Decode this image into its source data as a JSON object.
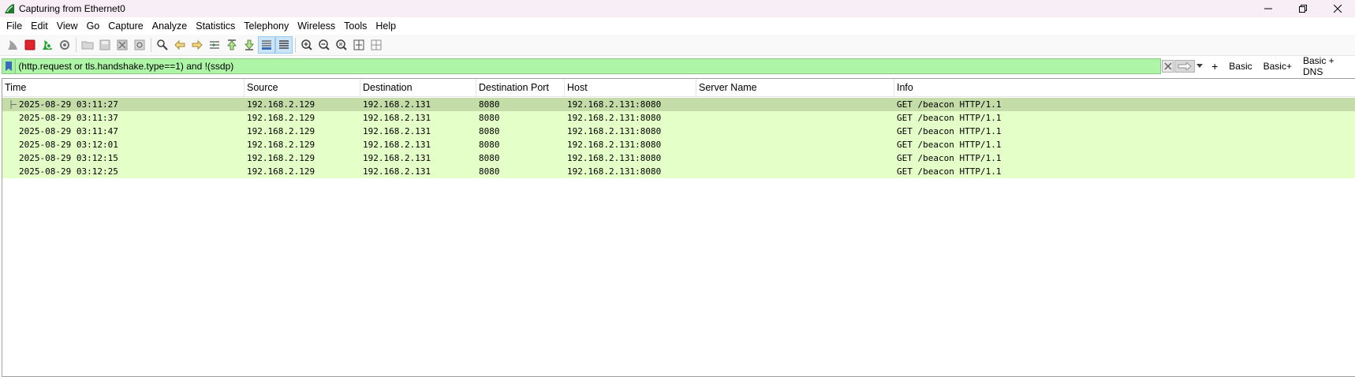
{
  "window": {
    "title": "Capturing from Ethernet0"
  },
  "menu": {
    "items": [
      "File",
      "Edit",
      "View",
      "Go",
      "Capture",
      "Analyze",
      "Statistics",
      "Telephony",
      "Wireless",
      "Tools",
      "Help"
    ]
  },
  "toolbar": {
    "icons": [
      "shark-fin-start-icon",
      "stop-capture-icon",
      "restart-capture-icon",
      "capture-options-icon",
      "open-file-icon",
      "save-file-icon",
      "close-file-icon",
      "reload-file-icon",
      "find-packet-icon",
      "go-back-icon",
      "go-forward-icon",
      "go-to-packet-icon",
      "first-packet-icon",
      "last-packet-icon",
      "autoscroll-icon",
      "colorize-icon",
      "zoom-in-icon",
      "zoom-out-icon",
      "normal-size-icon",
      "resize-columns-icon",
      "layout-icon"
    ]
  },
  "filter": {
    "value": "(http.request or tls.handshake.type==1) and !(ssdp)",
    "buttons": [
      "Basic",
      "Basic+",
      "Basic + DNS"
    ]
  },
  "packet_list": {
    "columns": [
      "Time",
      "Source",
      "Destination",
      "Destination Port",
      "Host",
      "Server Name",
      "Info"
    ],
    "rows": [
      {
        "time": "2025-08-29 03:11:27",
        "source": "192.168.2.129",
        "destination": "192.168.2.131",
        "dport": "8080",
        "host": "192.168.2.131:8080",
        "server_name": "",
        "info": "GET /beacon HTTP/1.1"
      },
      {
        "time": "2025-08-29 03:11:37",
        "source": "192.168.2.129",
        "destination": "192.168.2.131",
        "dport": "8080",
        "host": "192.168.2.131:8080",
        "server_name": "",
        "info": "GET /beacon HTTP/1.1"
      },
      {
        "time": "2025-08-29 03:11:47",
        "source": "192.168.2.129",
        "destination": "192.168.2.131",
        "dport": "8080",
        "host": "192.168.2.131:8080",
        "server_name": "",
        "info": "GET /beacon HTTP/1.1"
      },
      {
        "time": "2025-08-29 03:12:01",
        "source": "192.168.2.129",
        "destination": "192.168.2.131",
        "dport": "8080",
        "host": "192.168.2.131:8080",
        "server_name": "",
        "info": "GET /beacon HTTP/1.1"
      },
      {
        "time": "2025-08-29 03:12:15",
        "source": "192.168.2.129",
        "destination": "192.168.2.131",
        "dport": "8080",
        "host": "192.168.2.131:8080",
        "server_name": "",
        "info": "GET /beacon HTTP/1.1"
      },
      {
        "time": "2025-08-29 03:12:25",
        "source": "192.168.2.129",
        "destination": "192.168.2.131",
        "dport": "8080",
        "host": "192.168.2.131:8080",
        "server_name": "",
        "info": "GET /beacon HTTP/1.1"
      }
    ]
  },
  "colors": {
    "row_http": "#e4ffc7",
    "row_selected": "#c3dca8",
    "filter_valid": "#aff5a8",
    "title_bar": "#f8eef6"
  }
}
